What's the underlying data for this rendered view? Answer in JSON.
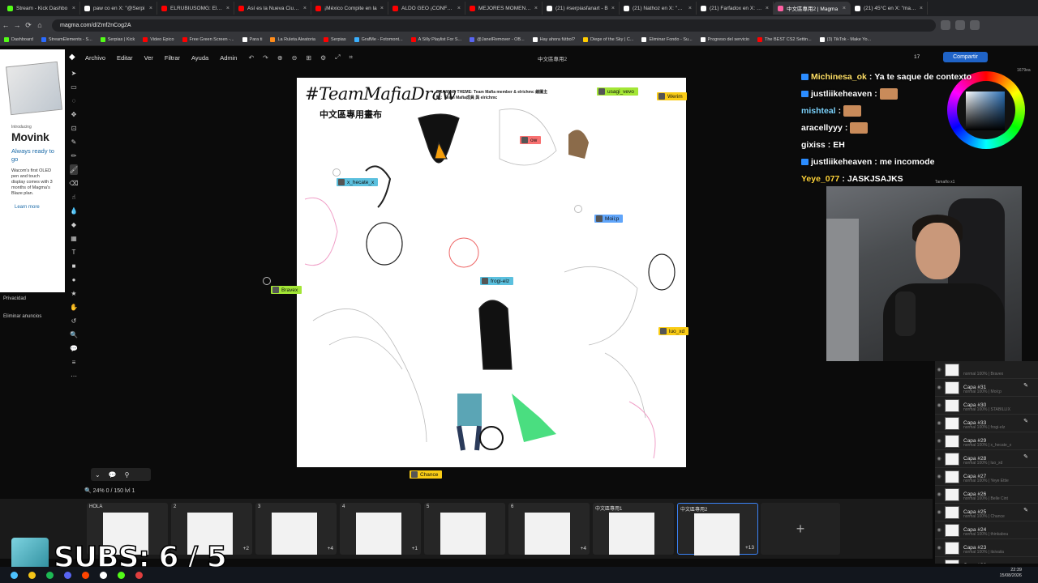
{
  "browser": {
    "tabs": [
      {
        "title": "Stream - Kick Dashbo",
        "color": "#53fc18"
      },
      {
        "title": "paw co en X: \"@Serpi",
        "color": "#ffffff"
      },
      {
        "title": "ELRUBIUSOMG: El You",
        "color": "#ff0000"
      },
      {
        "title": "Así es la Nueva Ciudad",
        "color": "#ff0000"
      },
      {
        "title": "¡México Compite en la",
        "color": "#ff0000"
      },
      {
        "title": "ALDO GEO ¡CONFRON",
        "color": "#ff0000"
      },
      {
        "title": "MEJORES MOMENTO",
        "color": "#ff0000"
      },
      {
        "title": "(21) #serpiasfanart - B",
        "color": "#ffffff"
      },
      {
        "title": "(21) Nathoz en X: \"El m",
        "color": "#ffffff"
      },
      {
        "title": "(21) Farfadox en X: \"Te",
        "color": "#ffffff"
      },
      {
        "title": "中文區專用2 | Magma",
        "color": "#ff5fa2",
        "active": true
      },
      {
        "title": "(21) 45°C en X: \"magm",
        "color": "#ffffff"
      }
    ],
    "url": "magma.com/d/Zmf2nCog2A",
    "bookmarks": [
      {
        "label": "Dashboard",
        "color": "#53fc18"
      },
      {
        "label": "StreamElements - S...",
        "color": "#2b6bff"
      },
      {
        "label": "Serpias | Kick",
        "color": "#53fc18"
      },
      {
        "label": "Video Epico",
        "color": "#ff0000"
      },
      {
        "label": "Free Green Screen -...",
        "color": "#ff0000"
      },
      {
        "label": "Para ti",
        "color": "#ffffff"
      },
      {
        "label": "La Ruleta Aleatoria",
        "color": "#ff8c1a"
      },
      {
        "label": "Serpias",
        "color": "#ff0000"
      },
      {
        "label": "GrafMe - Fotomont...",
        "color": "#3ab0ff"
      },
      {
        "label": "A Silly Playlist For S...",
        "color": "#ff0000"
      },
      {
        "label": "@JanelRemover - OB...",
        "color": "#5865f2"
      },
      {
        "label": "Hay ahora fútbol?",
        "color": "#ffffff"
      },
      {
        "label": "Diege of the Sky | C...",
        "color": "#ffcc00"
      },
      {
        "label": "Eliminar Fondo - Su...",
        "color": "#ffffff"
      },
      {
        "label": "Progreso del servicio",
        "color": "#ffffff"
      },
      {
        "label": "The BEST CS2 Settin...",
        "color": "#ff0000"
      },
      {
        "label": "(3) TikTok - Make Yo...",
        "color": "#ffffff"
      }
    ]
  },
  "ad": {
    "intro": "Introducing",
    "title": "Movink",
    "tagline": "Always ready to go",
    "body": "Wacom's first OLED pen and touch display comes with 3 months of Magma's Blaze plan.",
    "more": "Learn more",
    "privacy": "Privacidad",
    "remove": "Eliminar anuncios"
  },
  "app": {
    "menus": [
      "Archivo",
      "Editar",
      "Ver",
      "Filtrar",
      "Ayuda",
      "Admin"
    ],
    "doc_title": "中文區專用2",
    "share": "Compartir",
    "user_count": "17",
    "zoom": "24%",
    "layers_info": "0 / 150  lvl 1",
    "brush_label": "Tamaño x1"
  },
  "canvas": {
    "title": "#TeamMafiaDraw",
    "subtitle": "中文區專用畫布",
    "theme": "DRAWING THEME: Team Mafia member & elrichmc  繪圖主題：Team Mafia成員 與 elrichmc",
    "users": [
      {
        "name": "usagi_vevo",
        "color": "#a3e635"
      },
      {
        "name": "Werim",
        "color": "#facc15"
      },
      {
        "name": "x_hecate_x",
        "color": "#5bc0de"
      },
      {
        "name": "Moii;p",
        "color": "#60a5fa"
      },
      {
        "name": "Bravex",
        "color": "#a3e635"
      },
      {
        "name": "frogi-elz",
        "color": "#5bc0de"
      },
      {
        "name": "luo_xd",
        "color": "#facc15"
      },
      {
        "name": "Chance",
        "color": "#facc15"
      },
      {
        "name": "ow",
        "color": "#f87171"
      }
    ]
  },
  "chat": [
    {
      "user": "Michinesa_ok",
      "msg": "Ya te saque de contexto",
      "color": "#ffe066",
      "badge": true
    },
    {
      "user": "justliikeheaven",
      "msg": "",
      "color": "#ffffff",
      "badge": true,
      "emote": true
    },
    {
      "user": "mishteal",
      "msg": "",
      "color": "#7dd3fc",
      "badge": false,
      "emote": true
    },
    {
      "user": "aracellyyy",
      "msg": "",
      "color": "#ffffff",
      "badge": false,
      "emote": true
    },
    {
      "user": "gixiss",
      "msg": "EH",
      "color": "#ffffff",
      "badge": false
    },
    {
      "user": "justliikeheaven",
      "msg": "me incomode",
      "color": "#ffffff",
      "badge": true
    },
    {
      "user": "Yeye_077",
      "msg": "JASKJSAJKS",
      "color": "#ffd43b",
      "badge": false
    }
  ],
  "layers": [
    {
      "name": "",
      "sub": "normal 100% | Bravex",
      "pen": false
    },
    {
      "name": "Capa #31",
      "sub": "normal 100% | Moii;p",
      "pen": true
    },
    {
      "name": "Capa #30",
      "sub": "normal 100% | STABILLIX",
      "pen": false
    },
    {
      "name": "Capa #33",
      "sub": "normal 100% | frogi-elz",
      "pen": true
    },
    {
      "name": "Capa #29",
      "sub": "normal 100% | x_hecate_x",
      "pen": false
    },
    {
      "name": "Capa #28",
      "sub": "normal 100% | luo_xd",
      "pen": true
    },
    {
      "name": "Capa #27",
      "sub": "normal 100% | Yeye Ettie",
      "pen": false
    },
    {
      "name": "Capa #26",
      "sub": "normal 100% | Belle Cint",
      "pen": false
    },
    {
      "name": "Capa #25",
      "sub": "normal 100% | Chance",
      "pen": true
    },
    {
      "name": "Capa #24",
      "sub": "normal 100% | thinkabou",
      "pen": false
    },
    {
      "name": "Capa #23",
      "sub": "normal 100% | itsivaiia",
      "pen": false
    },
    {
      "name": "Capa #22",
      "sub": "",
      "pen": false
    }
  ],
  "pages": [
    {
      "label": "HOLA",
      "more": ""
    },
    {
      "label": "2",
      "more": "+2"
    },
    {
      "label": "3",
      "more": "+4"
    },
    {
      "label": "4",
      "more": "+1"
    },
    {
      "label": "5",
      "more": ""
    },
    {
      "label": "6",
      "more": "+4"
    },
    {
      "label": "中文區專用1",
      "more": ""
    },
    {
      "label": "中文區專用2",
      "more": "+13",
      "selected": true
    }
  ],
  "overlay": {
    "subs": "SUBS: 6 / 5"
  },
  "clock": {
    "time": "22:39",
    "date": "15/08/2026"
  },
  "rightinfo": "1679ea"
}
